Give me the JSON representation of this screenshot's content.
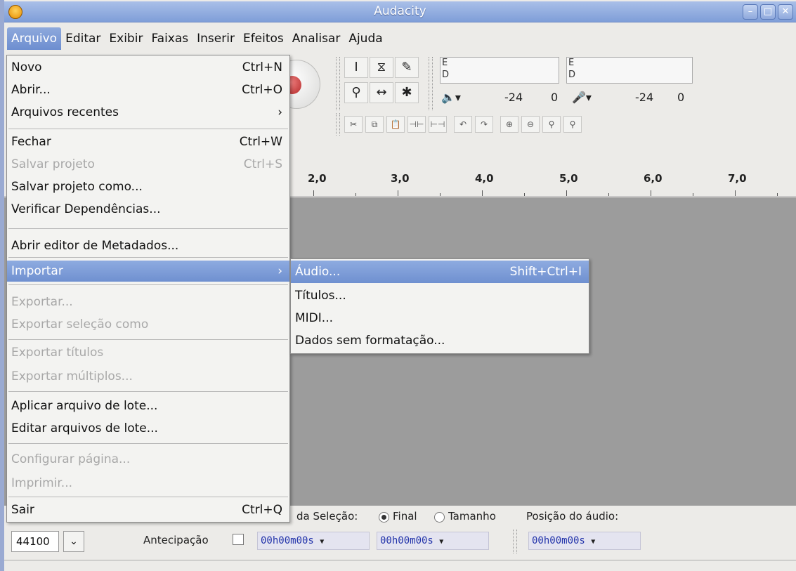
{
  "window": {
    "title": "Audacity"
  },
  "menubar": {
    "items": [
      "Arquivo",
      "Editar",
      "Exibir",
      "Faixas",
      "Inserir",
      "Efeitos",
      "Analisar",
      "Ajuda"
    ]
  },
  "file_menu": {
    "items": [
      {
        "label": "Novo",
        "shortcut": "Ctrl+N",
        "enabled": true
      },
      {
        "label": "Abrir...",
        "shortcut": "Ctrl+O",
        "enabled": true
      },
      {
        "label": "Arquivos recentes",
        "shortcut": "›",
        "enabled": true
      },
      {
        "label": "Fechar",
        "shortcut": "Ctrl+W",
        "enabled": true
      },
      {
        "label": "Salvar projeto",
        "shortcut": "Ctrl+S",
        "enabled": false
      },
      {
        "label": "Salvar projeto como...",
        "shortcut": "",
        "enabled": true
      },
      {
        "label": "Verificar Dependências...",
        "shortcut": "",
        "enabled": true
      },
      {
        "label": "Abrir editor de Metadados...",
        "shortcut": "",
        "enabled": true
      },
      {
        "label": "Importar",
        "shortcut": "›",
        "enabled": true
      },
      {
        "label": "Exportar...",
        "shortcut": "",
        "enabled": false
      },
      {
        "label": "Exportar seleção como",
        "shortcut": "",
        "enabled": false
      },
      {
        "label": "Exportar títulos",
        "shortcut": "",
        "enabled": false
      },
      {
        "label": "Exportar múltiplos...",
        "shortcut": "",
        "enabled": false
      },
      {
        "label": "Aplicar arquivo de lote...",
        "shortcut": "",
        "enabled": true
      },
      {
        "label": "Editar arquivos de lote...",
        "shortcut": "",
        "enabled": true
      },
      {
        "label": "Configurar página...",
        "shortcut": "",
        "enabled": false
      },
      {
        "label": "Imprimir...",
        "shortcut": "",
        "enabled": false
      },
      {
        "label": "Sair",
        "shortcut": "Ctrl+Q",
        "enabled": true
      }
    ]
  },
  "import_submenu": {
    "items": [
      {
        "label": "Áudio...",
        "shortcut": "Shift+Ctrl+I"
      },
      {
        "label": "Títulos...",
        "shortcut": ""
      },
      {
        "label": "MIDI...",
        "shortcut": ""
      },
      {
        "label": "Dados sem formatação...",
        "shortcut": ""
      }
    ]
  },
  "meters": {
    "playback_channels": [
      "E",
      "D"
    ],
    "record_channels": [
      "E",
      "D"
    ],
    "playback_scale": [
      "-24",
      "0"
    ],
    "record_scale": [
      "-24",
      "0"
    ]
  },
  "ruler": {
    "labels": [
      "2,0",
      "3,0",
      "4,0",
      "5,0",
      "6,0",
      "7,0"
    ]
  },
  "selection_bar": {
    "selection_label": "da Seleção:",
    "final_label": "Final",
    "length_label": "Tamanho",
    "audio_position_label": "Posição do áudio:",
    "snap_label": "Antecipação",
    "project_rate": "44100",
    "time_values": [
      "00h00m00s",
      "00h00m00s",
      "00h00m00s"
    ],
    "selected_option": "Final"
  },
  "colors": {
    "highlight": "#7f9ed8",
    "track_bg": "#9c9c9c",
    "disabled_text": "#a8a8a8"
  }
}
